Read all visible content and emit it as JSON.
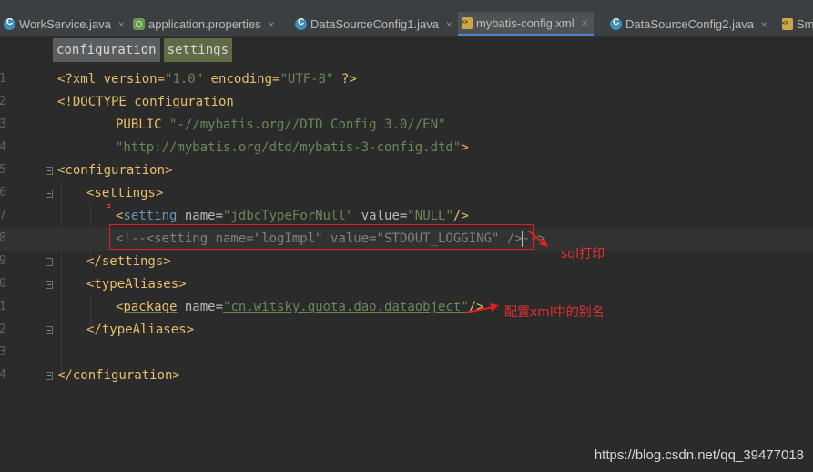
{
  "tabs": [
    {
      "label": "WorkService.java",
      "icon": "java-class-icon",
      "close": "×"
    },
    {
      "label": "application.properties",
      "icon": "properties-file-icon",
      "close": "×"
    },
    {
      "label": "DataSourceConfig1.java",
      "icon": "java-class-icon",
      "close": "×"
    },
    {
      "label": "mybatis-config.xml",
      "icon": "xml-file-icon",
      "close": "×"
    },
    {
      "label": "DataSourceConfig2.java",
      "icon": "java-class-icon",
      "close": "×"
    },
    {
      "label": "Sm",
      "icon": "xml-file-icon"
    }
  ],
  "breadcrumbs": [
    "configuration",
    "settings"
  ],
  "line_numbers": [
    "1",
    "2",
    "3",
    "4",
    "5",
    "6",
    "7",
    "8",
    "9",
    "0",
    "1",
    "2",
    "3",
    "4"
  ],
  "code": {
    "l1": {
      "a": "<?xml version=",
      "b": "\"1.0\"",
      "c": " encoding=",
      "d": "\"UTF-8\"",
      "e": " ?>"
    },
    "l2": {
      "a": "<!DOCTYPE configuration"
    },
    "l3": {
      "a": "PUBLIC ",
      "b": "\"-//mybatis.org//DTD Config 3.0//EN\""
    },
    "l4": {
      "a": "\"http://mybatis.org/dtd/mybatis-3-config.dtd\"",
      "b": ">"
    },
    "l5": {
      "a": "<configuration>"
    },
    "l6": {
      "a": "<settings>"
    },
    "l7": {
      "a": "<",
      "b": "setting",
      "c": " name=",
      "d": "\"jdbcTypeForNull\"",
      "e": " value=",
      "f": "\"NULL\"",
      "g": "/>"
    },
    "l8": {
      "a": "<!--<setting name=\"logImpl\" value=\"STDOUT_LOGGING\" />-->"
    },
    "l9": {
      "a": "</settings>"
    },
    "l10": {
      "a": "<typeAliases>"
    },
    "l11": {
      "a": "<",
      "b": "package",
      "c": " name=",
      "d": "\"cn.witsky.quota.dao.dataobject\"",
      "e": "/>"
    },
    "l12": {
      "a": "</typeAliases>"
    },
    "l13": {
      "a": ""
    },
    "l14": {
      "a": "</configuration>"
    }
  },
  "annotations": {
    "sql_print": "sql打印",
    "alias": "配置xml中的别名",
    "color": "#e02020"
  },
  "watermark": "https://blog.csdn.net/qq_39477018",
  "colors": {
    "background": "#2b2b2b",
    "tag": "#e8bf6a",
    "string": "#6a8759",
    "comment": "#808080",
    "active_tab_underline": "#4a88c7"
  }
}
